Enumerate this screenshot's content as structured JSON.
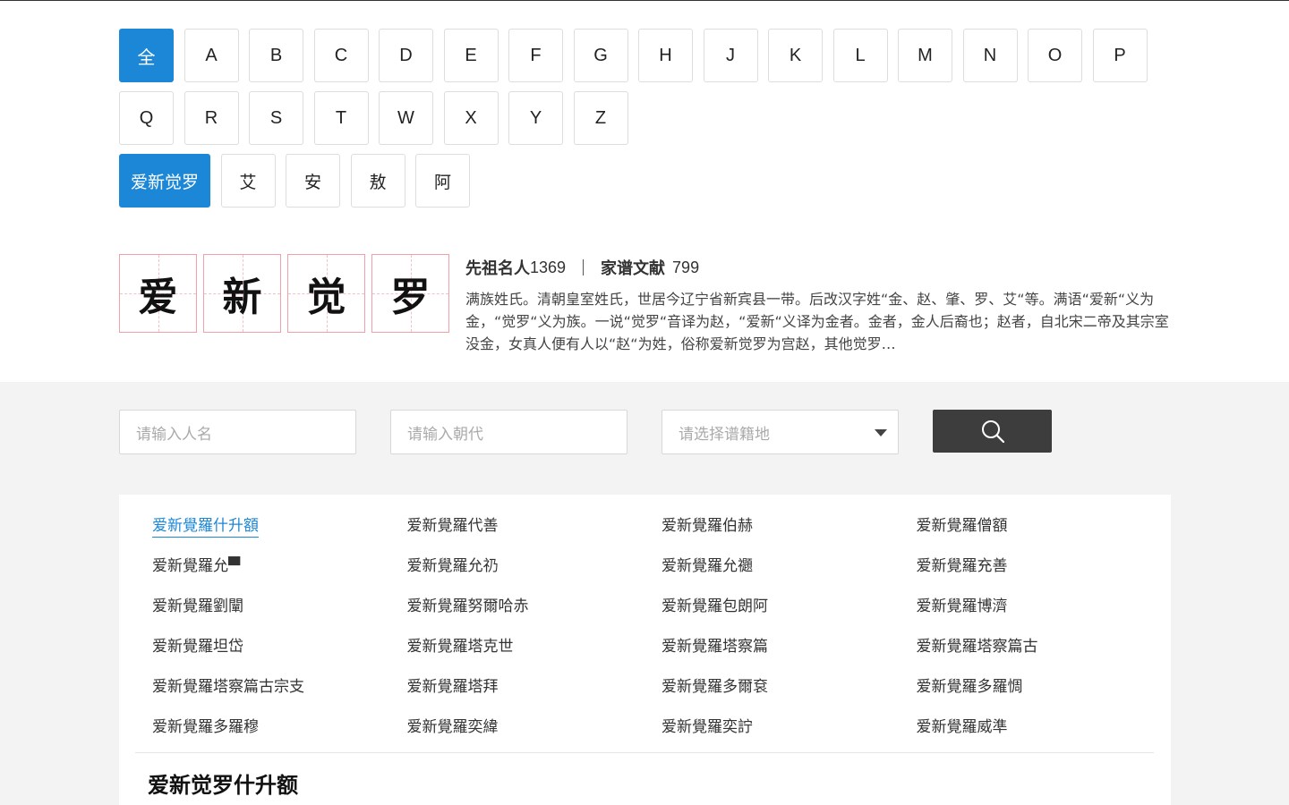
{
  "letters": {
    "row1": [
      "全",
      "A",
      "B",
      "C",
      "D",
      "E",
      "F",
      "G",
      "H",
      "J",
      "K",
      "L",
      "M",
      "N",
      "O",
      "P"
    ],
    "row2": [
      "Q",
      "R",
      "S",
      "T",
      "W",
      "X",
      "Y",
      "Z"
    ],
    "active": "全"
  },
  "surnames": {
    "items": [
      "爱新觉罗",
      "艾",
      "安",
      "敖",
      "阿"
    ],
    "active": "爱新觉罗"
  },
  "intro": {
    "chars": [
      "爱",
      "新",
      "觉",
      "罗"
    ],
    "ancestors_label": "先祖名人",
    "ancestors_count": "1369",
    "docs_label": "家谱文献",
    "docs_count": "799",
    "description": "满族姓氏。清朝皇室姓氏，世居今辽宁省新宾县一带。后改汉字姓“金、赵、肇、罗、艾“等。满语“爱新“义为金，“觉罗“义为族。一说“觉罗“音译为赵，“爱新“义译为金者。金者，金人后裔也；赵者，自北宋二帝及其宗室没金，女真人便有人以“赵“为姓，俗称爱新觉罗为宫赵，其他觉罗…"
  },
  "search": {
    "name_placeholder": "请输入人名",
    "dynasty_placeholder": "请输入朝代",
    "origin_placeholder": "请选择谱籍地",
    "button_icon": "search-icon"
  },
  "results": {
    "rows": [
      [
        "爱新覺羅什升額",
        "爱新覺羅代善",
        "爱新覺羅伯赫",
        "爱新覺羅僧額"
      ],
      [
        "爱新覺羅允▀",
        "爱新覺羅允礽",
        "爱新覺羅允禵",
        "爱新覺羅充善"
      ],
      [
        "爱新覺羅劉闡",
        "爱新覺羅努爾哈赤",
        "爱新覺羅包朗阿",
        "爱新覺羅博濟"
      ],
      [
        "爱新覺羅坦岱",
        "爱新覺羅塔克世",
        "爱新覺羅塔察篇",
        "爱新覺羅塔察篇古"
      ],
      [
        "爱新覺羅塔察篇古宗支",
        "爱新覺羅塔拜",
        "爱新覺羅多爾袞",
        "爱新覺羅多羅惆"
      ],
      [
        "爱新覺羅多羅穆",
        "爱新覺羅奕緯",
        "爱新覺羅奕詝",
        "爱新覺羅威準"
      ]
    ],
    "active": "爱新覺羅什升額",
    "detail_title": "爱新觉罗什升额"
  },
  "colors": {
    "accent": "#1d87d7",
    "search_button": "#3d3d3d",
    "band": "#f3f3f3"
  }
}
